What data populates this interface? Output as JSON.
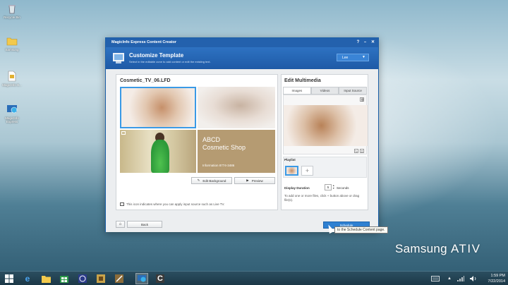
{
  "desktop": {
    "icons": [
      {
        "label": "Recycle Bin",
        "icon": "recycle-bin-icon"
      },
      {
        "label": "Samsung",
        "icon": "folder-icon"
      },
      {
        "label": "MagicInfo S...",
        "icon": "document-icon"
      },
      {
        "label": "MagicInfo Express",
        "icon": "magicinfo-icon"
      }
    ],
    "brand_prefix": "Samsung",
    "brand_name": "ATIV"
  },
  "window": {
    "title": "MagicInfo Express Content Creator",
    "help": "?",
    "minimize": "–",
    "close": "✕"
  },
  "header": {
    "title": "Customize Template",
    "subtitle": "Select in the editable zone to add content or edit the existing text.",
    "language": "Lee"
  },
  "left_panel": {
    "file_name": "Cosmetic_TV_06.LFD",
    "text_line1": "ABCD",
    "text_line2": "Cosmetic Shop",
    "text_info": "Information 8774-3486",
    "edit_bg": "Edit Background",
    "preview": "Preview",
    "hint": "This icon indicates where you can apply input source such as Live TV."
  },
  "right_panel": {
    "title": "Edit Multimedia",
    "tabs": [
      "Images",
      "Videos",
      "Input Source"
    ],
    "playlist": "Playlist",
    "display_duration": "Display Duration",
    "duration_value": "5",
    "duration_unit": "Seconds",
    "add_hint": "To add one or more files, click + button above or drag file(s)."
  },
  "footer": {
    "back": "Back",
    "schedule": "Schedule",
    "tooltip": "to the Schedule Content page."
  },
  "clock": {
    "time": "1:59 PM",
    "date": "7/22/2014"
  }
}
